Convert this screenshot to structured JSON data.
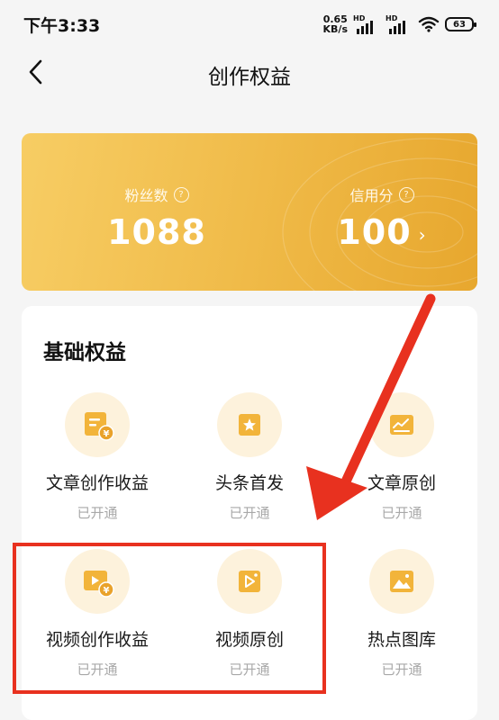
{
  "status_bar": {
    "time": "下午3:33",
    "net_speed_value": "0.65",
    "net_speed_unit": "KB/s",
    "signal_label_1": "HD",
    "signal_label_2": "HD",
    "battery": "63"
  },
  "nav": {
    "title": "创作权益",
    "back_icon": "chevron-left-icon"
  },
  "stats": {
    "fans_label": "粉丝数",
    "fans_value": "1088",
    "credit_label": "信用分",
    "credit_value": "100",
    "help_glyph": "?",
    "colors": {
      "banner_start": "#f7cd64",
      "banner_end": "#e7a72e"
    }
  },
  "benefits": {
    "title": "基础权益",
    "items": [
      {
        "label": "文章创作收益",
        "status": "已开通",
        "icon": "article-income-icon"
      },
      {
        "label": "头条首发",
        "status": "已开通",
        "icon": "star-icon"
      },
      {
        "label": "文章原创",
        "status": "已开通",
        "icon": "chart-icon"
      },
      {
        "label": "视频创作收益",
        "status": "已开通",
        "icon": "video-income-icon"
      },
      {
        "label": "视频原创",
        "status": "已开通",
        "icon": "video-original-icon"
      },
      {
        "label": "热点图库",
        "status": "已开通",
        "icon": "image-icon"
      }
    ]
  },
  "annotation": {
    "color": "#e8311f"
  }
}
